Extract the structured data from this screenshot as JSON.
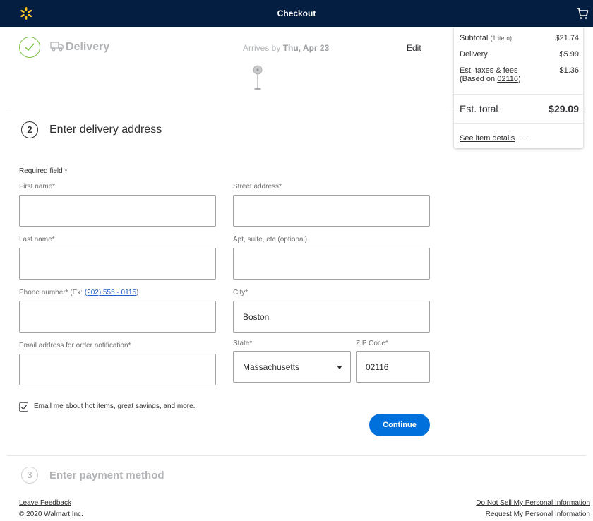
{
  "header": {
    "title": "Checkout"
  },
  "summary": {
    "subtotal_label": "Subtotal",
    "subtotal_note": "(1 item)",
    "subtotal_value": "$21.74",
    "delivery_label": "Delivery",
    "delivery_value": "$5.99",
    "taxes_label": "Est. taxes & fees",
    "taxes_note_prefix": "(Based on ",
    "taxes_zip": "02116",
    "taxes_note_suffix": ")",
    "taxes_value": "$1.36",
    "total_label": "Est. total",
    "total_value": "$29.09",
    "details_link": "See item details",
    "details_plus": "+"
  },
  "step1": {
    "title": "Delivery",
    "arrives_prefix": "Arrives by",
    "arrives_date": "Thu, Apr 23",
    "edit": "Edit"
  },
  "step2": {
    "number": "2",
    "title": "Enter delivery address",
    "required_note": "Required field *",
    "first_name_label": "First name*",
    "last_name_label": "Last name*",
    "phone_label": "Phone number* (Ex: ",
    "phone_example": "(202) 555 - 0115",
    "phone_label_end": ")",
    "email_label": "Email address for order notification*",
    "street_label": "Street address*",
    "apt_label": "Apt, suite, etc (optional)",
    "city_label": "City*",
    "city_value": "Boston",
    "state_label": "State*",
    "state_value": "Massachusetts",
    "zip_label": "ZIP Code*",
    "zip_value": "02116",
    "checkbox_label": "Email me about hot items, great savings, and more.",
    "continue": "Continue"
  },
  "step3": {
    "number": "3",
    "title": "Enter payment method"
  },
  "footer": {
    "feedback": "Leave Feedback",
    "copyright": "© 2020 Walmart Inc.",
    "do_not_sell": "Do Not Sell My Personal Information",
    "request_info": "Request My Personal Information"
  },
  "colors": {
    "header_bg": "#041e42",
    "spark": "#ffc220",
    "button": "#0071dc",
    "check": "#7ac142"
  },
  "icons": [
    "walmart-spark-icon",
    "cart-icon",
    "check-icon",
    "truck-icon",
    "fan-icon",
    "caret-down-icon",
    "checkbox-check-icon",
    "plus-icon"
  ]
}
